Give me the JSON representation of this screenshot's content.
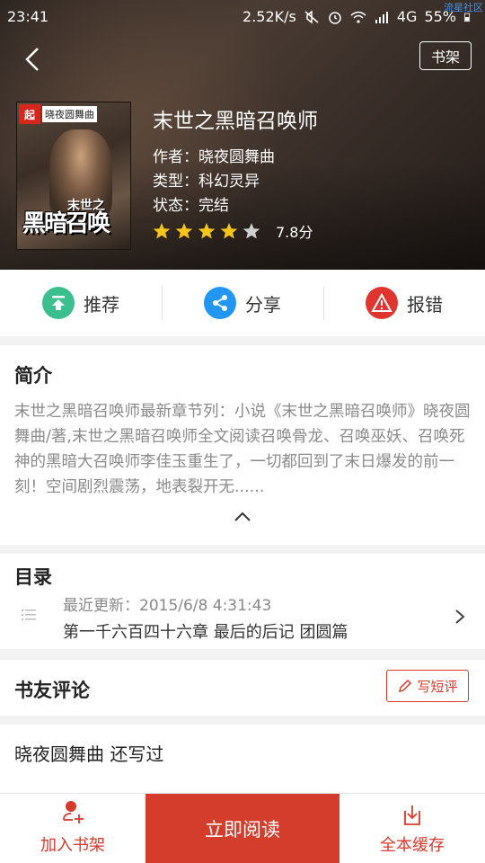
{
  "status_bar": {
    "time": "23:41",
    "network_speed": "2.52K/s",
    "network_type": "4G",
    "battery": "55%"
  },
  "watermark": "流星社区",
  "header": {
    "bookshelf_label": "书架"
  },
  "cover": {
    "badge": "起",
    "author_tag": "晓夜圆舞曲",
    "title_art": "黑暗召唤",
    "subtitle_art": "末世之"
  },
  "book": {
    "title": "末世之黑暗召唤师",
    "author": "作者：晓夜圆舞曲",
    "type": "类型：科幻灵异",
    "status": "状态：完结",
    "stars_filled": 4,
    "stars_total": 5,
    "score": "7.8分"
  },
  "actions": [
    {
      "label": "推荐",
      "icon": "upload-icon",
      "color": "#3bbf8e"
    },
    {
      "label": "分享",
      "icon": "share-icon",
      "color": "#2196f3"
    },
    {
      "label": "报错",
      "icon": "warning-icon",
      "color": "#e0352f"
    }
  ],
  "intro": {
    "title": "简介",
    "text": "末世之黑暗召唤师最新章节列：小说《末世之黑暗召唤师》晓夜圆舞曲/著,末世之黑暗召唤师全文阅读召唤骨龙、召唤巫妖、召唤死神的黑暗大召唤师李佳玉重生了，一切都回到了末日爆发的前一刻！空间剧烈震荡，地表裂开无......"
  },
  "toc": {
    "title": "目录",
    "updated": "最近更新：2015/6/8 4:31:43",
    "chapter": "第一千六百四十六章 最后的后记 团圆篇"
  },
  "comments": {
    "title": "书友评论",
    "write_label": "写短评",
    "first_comment": "晓夜圆舞曲  还写过"
  },
  "bottom_bar": {
    "add_label": "加入书架",
    "read_label": "立即阅读",
    "cache_label": "全本缓存"
  },
  "colors": {
    "accent": "#d43c2c",
    "green": "#3bbf8e",
    "blue": "#2196f3",
    "red": "#e0352f",
    "star": "#f5c518"
  }
}
